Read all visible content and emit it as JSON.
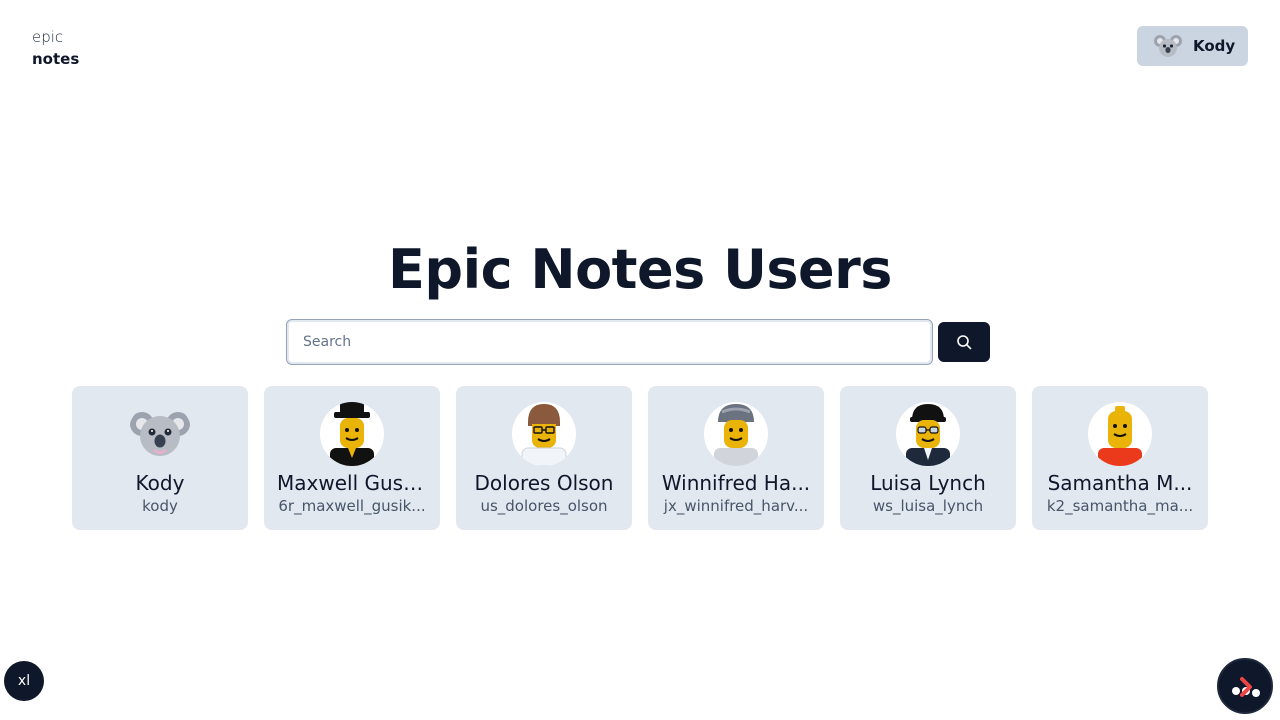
{
  "logo": {
    "line1": "epic",
    "line2": "notes"
  },
  "header": {
    "user_button_label": "Kody"
  },
  "page": {
    "title": "Epic Notes Users"
  },
  "search": {
    "placeholder": "Search",
    "value": ""
  },
  "users": [
    {
      "name": "Kody",
      "username": "kody",
      "avatar": "koala"
    },
    {
      "name": "Maxwell Gusi...",
      "username": "6r_maxwell_gusik...",
      "avatar": "minifig-black-hat"
    },
    {
      "name": "Dolores Olson",
      "username": "us_dolores_olson",
      "avatar": "minifig-brown-hair-glasses"
    },
    {
      "name": "Winnifred Ha...",
      "username": "jx_winnifred_harv...",
      "avatar": "minifig-grey-cap"
    },
    {
      "name": "Luisa Lynch",
      "username": "ws_luisa_lynch",
      "avatar": "minifig-black-cap-glasses"
    },
    {
      "name": "Samantha M...",
      "username": "k2_samantha_ma...",
      "avatar": "minifig-bald-red-shirt"
    }
  ],
  "footer": {
    "theme_label": "xl"
  },
  "colors": {
    "primary": "#0f172a",
    "card_bg": "#e2e8f0",
    "user_btn_bg": "#cbd5e1",
    "accent": "#ef4444"
  }
}
